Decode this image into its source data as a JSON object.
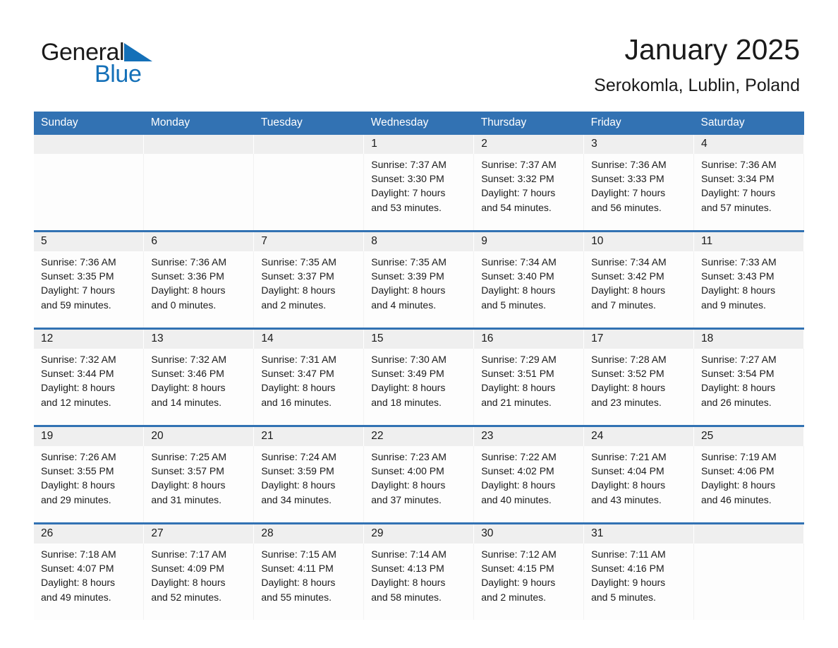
{
  "brand": {
    "name_part1": "General",
    "name_part2": "Blue",
    "logo_icon": "triangle-flag-icon",
    "accent_color": "#1470b8"
  },
  "header": {
    "title": "January 2025",
    "subtitle": "Serokomla, Lublin, Poland"
  },
  "theme": {
    "header_blue": "#3272b3",
    "daynum_band": "#efefef",
    "cell_bg": "#fdfdfd"
  },
  "weekday_headers": [
    "Sunday",
    "Monday",
    "Tuesday",
    "Wednesday",
    "Thursday",
    "Friday",
    "Saturday"
  ],
  "weeks": [
    [
      {
        "day": "",
        "l1": "",
        "l2": "",
        "l3": "",
        "l4": ""
      },
      {
        "day": "",
        "l1": "",
        "l2": "",
        "l3": "",
        "l4": ""
      },
      {
        "day": "",
        "l1": "",
        "l2": "",
        "l3": "",
        "l4": ""
      },
      {
        "day": "1",
        "l1": "Sunrise: 7:37 AM",
        "l2": "Sunset: 3:30 PM",
        "l3": "Daylight: 7 hours",
        "l4": "and 53 minutes."
      },
      {
        "day": "2",
        "l1": "Sunrise: 7:37 AM",
        "l2": "Sunset: 3:32 PM",
        "l3": "Daylight: 7 hours",
        "l4": "and 54 minutes."
      },
      {
        "day": "3",
        "l1": "Sunrise: 7:36 AM",
        "l2": "Sunset: 3:33 PM",
        "l3": "Daylight: 7 hours",
        "l4": "and 56 minutes."
      },
      {
        "day": "4",
        "l1": "Sunrise: 7:36 AM",
        "l2": "Sunset: 3:34 PM",
        "l3": "Daylight: 7 hours",
        "l4": "and 57 minutes."
      }
    ],
    [
      {
        "day": "5",
        "l1": "Sunrise: 7:36 AM",
        "l2": "Sunset: 3:35 PM",
        "l3": "Daylight: 7 hours",
        "l4": "and 59 minutes."
      },
      {
        "day": "6",
        "l1": "Sunrise: 7:36 AM",
        "l2": "Sunset: 3:36 PM",
        "l3": "Daylight: 8 hours",
        "l4": "and 0 minutes."
      },
      {
        "day": "7",
        "l1": "Sunrise: 7:35 AM",
        "l2": "Sunset: 3:37 PM",
        "l3": "Daylight: 8 hours",
        "l4": "and 2 minutes."
      },
      {
        "day": "8",
        "l1": "Sunrise: 7:35 AM",
        "l2": "Sunset: 3:39 PM",
        "l3": "Daylight: 8 hours",
        "l4": "and 4 minutes."
      },
      {
        "day": "9",
        "l1": "Sunrise: 7:34 AM",
        "l2": "Sunset: 3:40 PM",
        "l3": "Daylight: 8 hours",
        "l4": "and 5 minutes."
      },
      {
        "day": "10",
        "l1": "Sunrise: 7:34 AM",
        "l2": "Sunset: 3:42 PM",
        "l3": "Daylight: 8 hours",
        "l4": "and 7 minutes."
      },
      {
        "day": "11",
        "l1": "Sunrise: 7:33 AM",
        "l2": "Sunset: 3:43 PM",
        "l3": "Daylight: 8 hours",
        "l4": "and 9 minutes."
      }
    ],
    [
      {
        "day": "12",
        "l1": "Sunrise: 7:32 AM",
        "l2": "Sunset: 3:44 PM",
        "l3": "Daylight: 8 hours",
        "l4": "and 12 minutes."
      },
      {
        "day": "13",
        "l1": "Sunrise: 7:32 AM",
        "l2": "Sunset: 3:46 PM",
        "l3": "Daylight: 8 hours",
        "l4": "and 14 minutes."
      },
      {
        "day": "14",
        "l1": "Sunrise: 7:31 AM",
        "l2": "Sunset: 3:47 PM",
        "l3": "Daylight: 8 hours",
        "l4": "and 16 minutes."
      },
      {
        "day": "15",
        "l1": "Sunrise: 7:30 AM",
        "l2": "Sunset: 3:49 PM",
        "l3": "Daylight: 8 hours",
        "l4": "and 18 minutes."
      },
      {
        "day": "16",
        "l1": "Sunrise: 7:29 AM",
        "l2": "Sunset: 3:51 PM",
        "l3": "Daylight: 8 hours",
        "l4": "and 21 minutes."
      },
      {
        "day": "17",
        "l1": "Sunrise: 7:28 AM",
        "l2": "Sunset: 3:52 PM",
        "l3": "Daylight: 8 hours",
        "l4": "and 23 minutes."
      },
      {
        "day": "18",
        "l1": "Sunrise: 7:27 AM",
        "l2": "Sunset: 3:54 PM",
        "l3": "Daylight: 8 hours",
        "l4": "and 26 minutes."
      }
    ],
    [
      {
        "day": "19",
        "l1": "Sunrise: 7:26 AM",
        "l2": "Sunset: 3:55 PM",
        "l3": "Daylight: 8 hours",
        "l4": "and 29 minutes."
      },
      {
        "day": "20",
        "l1": "Sunrise: 7:25 AM",
        "l2": "Sunset: 3:57 PM",
        "l3": "Daylight: 8 hours",
        "l4": "and 31 minutes."
      },
      {
        "day": "21",
        "l1": "Sunrise: 7:24 AM",
        "l2": "Sunset: 3:59 PM",
        "l3": "Daylight: 8 hours",
        "l4": "and 34 minutes."
      },
      {
        "day": "22",
        "l1": "Sunrise: 7:23 AM",
        "l2": "Sunset: 4:00 PM",
        "l3": "Daylight: 8 hours",
        "l4": "and 37 minutes."
      },
      {
        "day": "23",
        "l1": "Sunrise: 7:22 AM",
        "l2": "Sunset: 4:02 PM",
        "l3": "Daylight: 8 hours",
        "l4": "and 40 minutes."
      },
      {
        "day": "24",
        "l1": "Sunrise: 7:21 AM",
        "l2": "Sunset: 4:04 PM",
        "l3": "Daylight: 8 hours",
        "l4": "and 43 minutes."
      },
      {
        "day": "25",
        "l1": "Sunrise: 7:19 AM",
        "l2": "Sunset: 4:06 PM",
        "l3": "Daylight: 8 hours",
        "l4": "and 46 minutes."
      }
    ],
    [
      {
        "day": "26",
        "l1": "Sunrise: 7:18 AM",
        "l2": "Sunset: 4:07 PM",
        "l3": "Daylight: 8 hours",
        "l4": "and 49 minutes."
      },
      {
        "day": "27",
        "l1": "Sunrise: 7:17 AM",
        "l2": "Sunset: 4:09 PM",
        "l3": "Daylight: 8 hours",
        "l4": "and 52 minutes."
      },
      {
        "day": "28",
        "l1": "Sunrise: 7:15 AM",
        "l2": "Sunset: 4:11 PM",
        "l3": "Daylight: 8 hours",
        "l4": "and 55 minutes."
      },
      {
        "day": "29",
        "l1": "Sunrise: 7:14 AM",
        "l2": "Sunset: 4:13 PM",
        "l3": "Daylight: 8 hours",
        "l4": "and 58 minutes."
      },
      {
        "day": "30",
        "l1": "Sunrise: 7:12 AM",
        "l2": "Sunset: 4:15 PM",
        "l3": "Daylight: 9 hours",
        "l4": "and 2 minutes."
      },
      {
        "day": "31",
        "l1": "Sunrise: 7:11 AM",
        "l2": "Sunset: 4:16 PM",
        "l3": "Daylight: 9 hours",
        "l4": "and 5 minutes."
      },
      {
        "day": "",
        "l1": "",
        "l2": "",
        "l3": "",
        "l4": ""
      }
    ]
  ]
}
